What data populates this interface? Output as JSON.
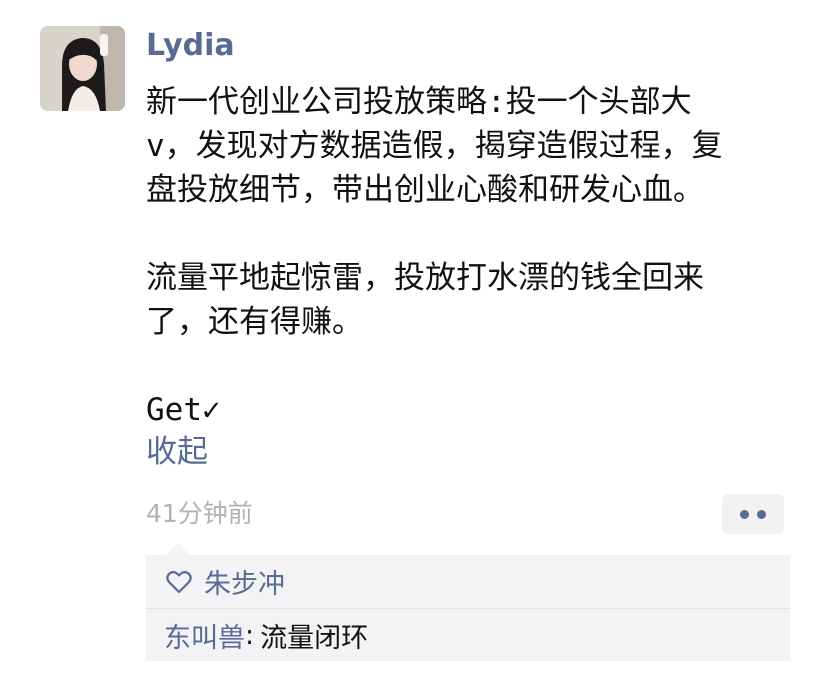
{
  "post": {
    "author": "Lydia",
    "body": "新一代创业公司投放策略:投一个头部大\nv，发现对方数据造假，揭穿造假过程，复\n盘投放细节，带出创业心酸和研发心血。\n\n流量平地起惊雷，投放打水漂的钱全回来\n了，还有得赚。\n\nGet✓",
    "collapse_label": "收起",
    "timestamp": "41分钟前",
    "more_icon": "more-dots-icon"
  },
  "likes": {
    "icon": "heart-icon",
    "names": [
      "朱步冲"
    ]
  },
  "comments": [
    {
      "author": "东叫兽",
      "separator": ":",
      "text": "流量闭环"
    }
  ],
  "colors": {
    "link": "#576b95",
    "text": "#111111",
    "muted": "#b2b2b2",
    "panel_bg": "#f3f3f5"
  }
}
